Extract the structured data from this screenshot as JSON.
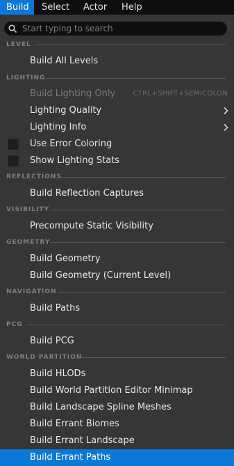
{
  "menubar": {
    "tabs": [
      {
        "label": "Build"
      },
      {
        "label": "Select"
      },
      {
        "label": "Actor"
      },
      {
        "label": "Help"
      }
    ]
  },
  "search": {
    "placeholder": "Start typing to search"
  },
  "sections": {
    "level": "LEVEL",
    "lighting": "LIGHTING",
    "reflections": "REFLECTIONS",
    "visibility": "VISIBILITY",
    "geometry": "GEOMETRY",
    "navigation": "NAVIGATION",
    "pcg": "PCG",
    "world_partition": "WORLD PARTITION"
  },
  "items": {
    "build_all_levels": "Build All Levels",
    "build_lighting_only": "Build Lighting Only",
    "build_lighting_only_shortcut": "CTRL+SHIFT+SEMICOLON",
    "lighting_quality": "Lighting Quality",
    "lighting_info": "Lighting Info",
    "use_error_coloring": "Use Error Coloring",
    "show_lighting_stats": "Show Lighting Stats",
    "build_reflection_captures": "Build Reflection Captures",
    "precompute_static_visibility": "Precompute Static Visibility",
    "build_geometry": "Build Geometry",
    "build_geometry_current_level": "Build Geometry (Current Level)",
    "build_paths": "Build Paths",
    "build_pcg": "Build PCG",
    "build_hlods": "Build HLODs",
    "build_wp_editor_minimap": "Build World Partition Editor Minimap",
    "build_landscape_spline_meshes": "Build Landscape Spline Meshes",
    "build_errant_biomes": "Build Errant Biomes",
    "build_errant_landscape": "Build Errant Landscape",
    "build_errant_paths": "Build Errant Paths"
  },
  "colors": {
    "accent": "#0a78d7",
    "panel": "#363636",
    "menubar": "#0f0f0f"
  }
}
